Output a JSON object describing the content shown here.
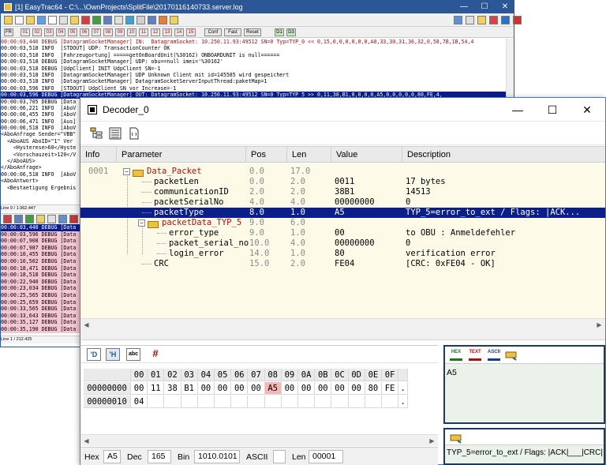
{
  "bg_window": {
    "title": "[1] EasyTrac64 - C:\\...\\OwnProjects\\SplitFile\\20170116140733.server.log",
    "controls": [
      "—",
      "☐",
      "✕"
    ],
    "filter_buttons": [
      "FR",
      "01",
      "02",
      "03",
      "04",
      "05",
      "06",
      "07",
      "08",
      "09",
      "10",
      "11",
      "12",
      "13",
      "14",
      "15",
      "Conf",
      "Fast",
      "Reset",
      "D1",
      "D3"
    ],
    "log_lines": [
      "00:00:03,440 DEBUG [DatagramSocketManager] IN:  DatagramSocket: 10.250.11.93:49512 SN=0 Typ=TYP_0 << 0,15,0,0,0,0,0,0,A0,33,30,31,36,32,0,58,7B,1B,54,4",
      "00:00:03,518 INFO  [STDOUT] UDP: TransactionCounter OK",
      "00:00:03,518 INFO  [Fahrzeugortung] =====getOnBoardUnit(%30162) ONBOARDUNIT is null======",
      "00:00:03,518 DEBUG [DatagramSocketManager] UDP: obu==null imei='%30162'",
      "00:00:03,518 DEBUG [UdpClient] INIT UdpClient SN=-1",
      "00:00:03,518 INFO  [DatagramSocketManager] UDP Unknown Client mit id=145585 wird gespeichert",
      "00:00:03,518 INFO  [DatagramSocketManager] DatagramSocketServerInputThread:paketMap=1",
      "00:00:03,596 INFO  [STDOUT] UdpClient SN vor Increase=-1",
      "00:00:03,596 DEBUG [DatagramSocketManager] OUT: DatagramSocket: 10.250.11.93:49512 SN=0 Typ=TYP_5 >> 0,11,38,B1,0,0,0,0,A5,0,0,0,0,0,80,FE,4,",
      "00:00:03,705 DEBUG [Data",
      "00:00:06,221 INFO  [AboV",
      "00:00:06,455 INFO  [AboV",
      "00:00:06,471 INFO  [Aus]",
      "00:00:06,518 INFO  [AboV",
      "<AboAnfrage Sender=\"VBB\"",
      "  <AboAUS AboID=\"1\" Ver",
      "    <Hysterese>60</Hyste",
      "    <Vorschauzeit>120</V",
      "  </AboAUS>",
      "</AboAnfrage>",
      "00:00:06,518 INFO  [AboV",
      "<AboAntwort>",
      "  <Bestaetigung Ergebnis"
    ],
    "status1": "Line     9 / 1.962.447",
    "log2_lines": [
      "00:00:03,440 DEBUG [Data",
      "00:00:03,596 DEBUG [Data",
      "00:00:07,908 DEBUG [Data",
      "00:00:07,987 DEBUG [Data",
      "00:00:10,455 DEBUG [Data",
      "00:00:10,502 DEBUG [Data",
      "00:00:18,471 DEBUG [Data",
      "00:00:18,518 DEBUG [Data",
      "00:00:22,940 DEBUG [Data",
      "00:00:23,034 DEBUG [Data",
      "00:00:25,565 DEBUG [Data",
      "00:00:25,659 DEBUG [Data",
      "00:00:33,565 DEBUG [Data",
      "00:00:33,643 DEBUG [Data",
      "00:00:35,127 DEBUG [Data",
      "00:00:35,190 DEBUG [Data"
    ],
    "status2": "Line     1 / 212.425"
  },
  "decoder": {
    "title": "Decoder_0",
    "columns": [
      "Info",
      "Parameter",
      "Pos",
      "Len",
      "Value",
      "Description"
    ],
    "rows": [
      {
        "info": "0001",
        "param": "Data_Packet",
        "pos": "0.0",
        "len": "17.0",
        "value": "",
        "desc": "",
        "level": 0,
        "node": "folder",
        "selected": false
      },
      {
        "info": "",
        "param": "packetLen",
        "pos": "0.0",
        "len": "2.0",
        "value": "0011",
        "desc": "17 bytes",
        "level": 1,
        "node": "leaf",
        "selected": false
      },
      {
        "info": "",
        "param": "communicationID",
        "pos": "2.0",
        "len": "2.0",
        "value": "38B1",
        "desc": "14513",
        "level": 1,
        "node": "leaf",
        "selected": false
      },
      {
        "info": "",
        "param": "packetSerialNo",
        "pos": "4.0",
        "len": "4.0",
        "value": "00000000",
        "desc": "0",
        "level": 1,
        "node": "leaf",
        "selected": false
      },
      {
        "info": "",
        "param": "packetType",
        "pos": "8.0",
        "len": "1.0",
        "value": "A5",
        "desc": "TYP_5=error_to_ext / Flags: |ACK...",
        "level": 1,
        "node": "leaf",
        "selected": true
      },
      {
        "info": "",
        "param": "packetData_TYP_5",
        "pos": "9.0",
        "len": "6.0",
        "value": "",
        "desc": "",
        "level": 1,
        "node": "folder",
        "selected": false
      },
      {
        "info": "",
        "param": "error_type",
        "pos": "9.0",
        "len": "1.0",
        "value": "00",
        "desc": "to OBU : Anmeldefehler",
        "level": 2,
        "node": "leaf",
        "selected": false
      },
      {
        "info": "",
        "param": "packet_serial_no",
        "pos": "10.0",
        "len": "4.0",
        "value": "00000000",
        "desc": "0",
        "level": 2,
        "node": "leaf",
        "selected": false
      },
      {
        "info": "",
        "param": "login_error",
        "pos": "14.0",
        "len": "1.0",
        "value": "80",
        "desc": "verification error",
        "level": 2,
        "node": "leaf",
        "selected": false
      },
      {
        "info": "",
        "param": "CRC",
        "pos": "15.0",
        "len": "2.0",
        "value": "FE04",
        "desc": "[CRC: 0xFE04 - OK]",
        "level": 1,
        "node": "leaf",
        "selected": false
      }
    ],
    "hex_tools": [
      "'D",
      "'H",
      "abc",
      "#"
    ],
    "hex_columns": [
      "00",
      "01",
      "02",
      "03",
      "04",
      "05",
      "06",
      "07",
      "08",
      "09",
      "0A",
      "0B",
      "0C",
      "0D",
      "0E",
      "0F",
      ""
    ],
    "hex_rows": [
      {
        "addr": "00000000",
        "bytes": [
          "00",
          "11",
          "38",
          "B1",
          "00",
          "00",
          "00",
          "00",
          "A5",
          "00",
          "00",
          "00",
          "00",
          "00",
          "80",
          "FE",
          "."
        ]
      },
      {
        "addr": "00000010",
        "bytes": [
          "04",
          "",
          "",
          "",
          "",
          "",
          "",
          "",
          "",
          "",
          "",
          "",
          "",
          "",
          "",
          "",
          "."
        ]
      }
    ],
    "selected_byte_index": 8,
    "status": {
      "hex_label": "Hex",
      "hex_value": "A5",
      "dec_label": "Dec",
      "dec_value": "165",
      "bin_label": "Bin",
      "bin_value": "1010.0101",
      "ascii_label": "ASCII",
      "ascii_value": "",
      "len_label": "Len",
      "len_value": "00001"
    },
    "right_icons": [
      "HEX",
      "TEXT",
      "ASCII"
    ],
    "right_value": "A5",
    "right_desc": "TYP_5=error_to_ext / Flags: |ACK|___|CRC|"
  },
  "colors": {
    "selection": "#0a1e8c",
    "tree_background": "#fdfbe8",
    "folder": "#f0c040",
    "hex_highlight": "#f3b7b7",
    "log_pink": "#f3c8d4",
    "title_blue": "#2b5797",
    "pane_green": "#eaf2ea"
  }
}
